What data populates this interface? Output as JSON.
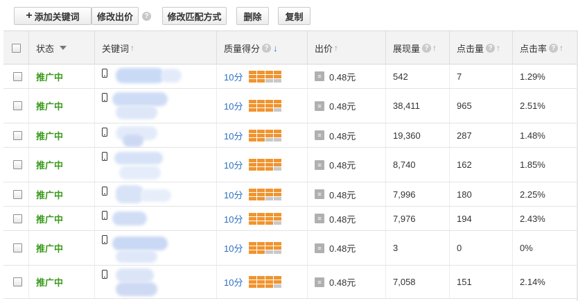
{
  "toolbar": {
    "add_keyword": "添加关键词",
    "edit_bid": "修改出价",
    "help": "?",
    "edit_match": "修改匹配方式",
    "delete": "删除",
    "copy": "复制"
  },
  "columns": {
    "status": "状态",
    "keyword": "关键词",
    "quality": "质量得分",
    "bid": "出价",
    "impressions": "展现量",
    "clicks": "点击量",
    "ctr": "点击率"
  },
  "icons": {
    "sort": "↑",
    "sort_active": "↓",
    "help": "?"
  },
  "colors": {
    "status_green": "#3a9a1b",
    "score_blue": "#2a6fc1",
    "bar_orange": "#f0942f"
  },
  "rows": [
    {
      "status": "推广中",
      "score": "10分",
      "bid": "0.48元",
      "impressions": "542",
      "clicks": "7",
      "ctr": "1.29%"
    },
    {
      "status": "推广中",
      "score": "10分",
      "bid": "0.48元",
      "impressions": "38,411",
      "clicks": "965",
      "ctr": "2.51%"
    },
    {
      "status": "推广中",
      "score": "10分",
      "bid": "0.48元",
      "impressions": "19,360",
      "clicks": "287",
      "ctr": "1.48%"
    },
    {
      "status": "推广中",
      "score": "10分",
      "bid": "0.48元",
      "impressions": "8,740",
      "clicks": "162",
      "ctr": "1.85%"
    },
    {
      "status": "推广中",
      "score": "10分",
      "bid": "0.48元",
      "impressions": "7,996",
      "clicks": "180",
      "ctr": "2.25%"
    },
    {
      "status": "推广中",
      "score": "10分",
      "bid": "0.48元",
      "impressions": "7,976",
      "clicks": "194",
      "ctr": "2.43%"
    },
    {
      "status": "推广中",
      "score": "10分",
      "bid": "0.48元",
      "impressions": "3",
      "clicks": "0",
      "ctr": "0%"
    },
    {
      "status": "推广中",
      "score": "10分",
      "bid": "0.48元",
      "impressions": "7,058",
      "clicks": "151",
      "ctr": "2.14%"
    }
  ]
}
